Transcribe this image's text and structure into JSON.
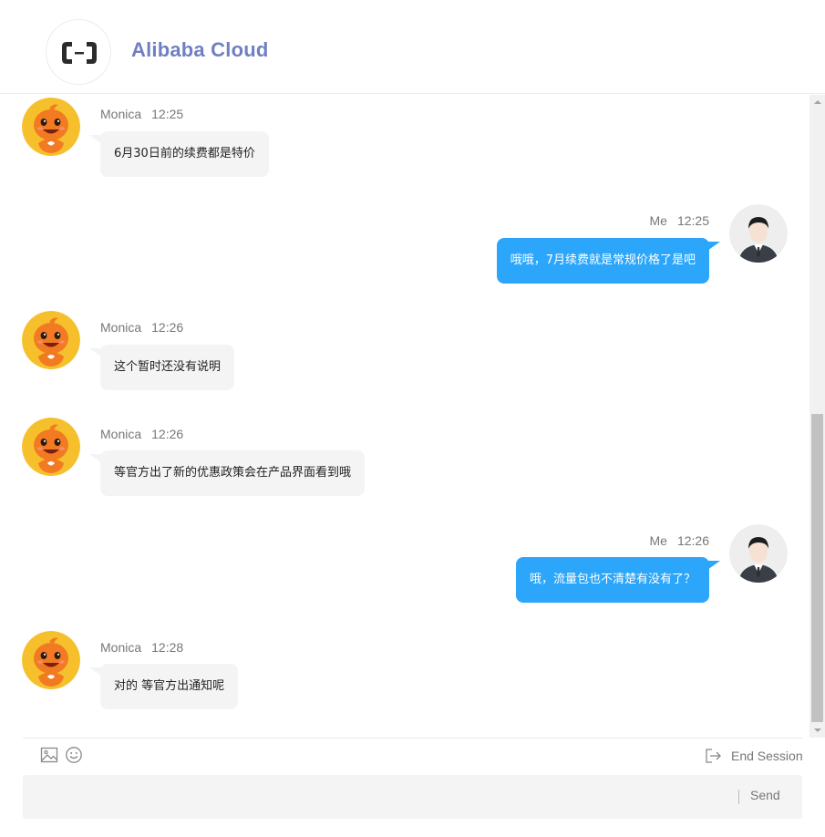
{
  "header": {
    "brand": "Alibaba Cloud"
  },
  "messages": [
    {
      "sender": "Monica",
      "time": "12:25",
      "text": "6月30日前的续费都是特价",
      "direction": "in"
    },
    {
      "sender": "Me",
      "time": "12:25",
      "text": "哦哦，7月续费就是常规价格了是吧",
      "direction": "out"
    },
    {
      "sender": "Monica",
      "time": "12:26",
      "text": "这个暂时还没有说明",
      "direction": "in"
    },
    {
      "sender": "Monica",
      "time": "12:26",
      "text": "等官方出了新的优惠政策会在产品界面看到哦",
      "direction": "in"
    },
    {
      "sender": "Me",
      "time": "12:26",
      "text": "哦，流量包也不清楚有没有了？",
      "direction": "out"
    },
    {
      "sender": "Monica",
      "time": "12:28",
      "text": "对的 等官方出通知呢",
      "direction": "in"
    }
  ],
  "toolbar": {
    "end_session": "End Session"
  },
  "composer": {
    "value": "",
    "send_label": "Send"
  },
  "colors": {
    "brand": "#6f7fc2",
    "outgoing_bubble": "#2ba6fa",
    "incoming_bubble": "#f4f4f4"
  },
  "icons": [
    "alibaba-cloud-logo-icon",
    "image-icon",
    "emoji-icon",
    "exit-icon"
  ]
}
